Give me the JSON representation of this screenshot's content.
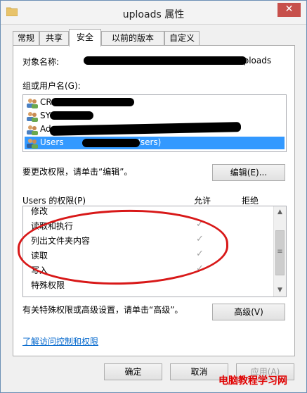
{
  "window": {
    "title": "uploads 属性",
    "close_label": "✕"
  },
  "tabs": [
    {
      "label": "常规"
    },
    {
      "label": "共享"
    },
    {
      "label": "安全"
    },
    {
      "label": "以前的版本"
    },
    {
      "label": "自定义"
    }
  ],
  "security": {
    "object_label": "对象名称:",
    "object_value_suffix": "uploads",
    "group_label": "组或用户名(G):",
    "users": [
      {
        "name": "CR"
      },
      {
        "name": "SY"
      },
      {
        "name": "Ad"
      },
      {
        "name": "Users",
        "name_suffix": "\\Users)"
      }
    ],
    "change_hint": "要更改权限，请单击“编辑”。",
    "edit_button": "编辑(E)...",
    "perm_header": "Users 的权限(P)",
    "allow_header": "允许",
    "deny_header": "拒绝",
    "permissions": [
      {
        "name": "修改",
        "allow": ""
      },
      {
        "name": "读取和执行",
        "allow": "✓"
      },
      {
        "name": "列出文件夹内容",
        "allow": "✓"
      },
      {
        "name": "读取",
        "allow": "✓"
      },
      {
        "name": "写入",
        "allow": "✓"
      },
      {
        "name": "特殊权限",
        "allow": ""
      }
    ],
    "advanced_hint": "有关特殊权限或高级设置，请单击“高级”。",
    "advanced_button": "高级(V)",
    "learn_link": "了解访问控制和权限"
  },
  "footer": {
    "ok_button": "确定",
    "cancel_button": "取消",
    "apply_button": "应用(A)"
  },
  "watermark": "电脑教程学习网",
  "colors": {
    "selection": "#3399ff",
    "annotation": "#d81818",
    "link": "#0066cc"
  }
}
